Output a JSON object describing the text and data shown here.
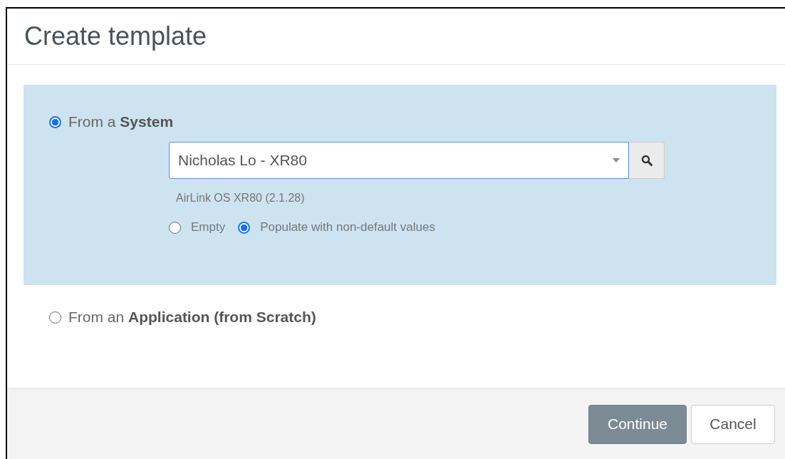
{
  "dialog": {
    "title": "Create template"
  },
  "sources": [
    {
      "label": "From a **System**",
      "selected": true,
      "system": {
        "value": "Nicholas Lo - XR80",
        "description": "AirLink OS XR80 (2.1.28)",
        "modes": [
          {
            "label": "Empty",
            "selected": false
          },
          {
            "label": "Populate with non-default values",
            "selected": true
          }
        ]
      }
    },
    {
      "label": "From an **Application (from Scratch)**",
      "selected": false
    }
  ],
  "buttons": [
    {
      "label": "Continue",
      "kind": "primary"
    },
    {
      "label": "Cancel",
      "kind": "default"
    }
  ]
}
